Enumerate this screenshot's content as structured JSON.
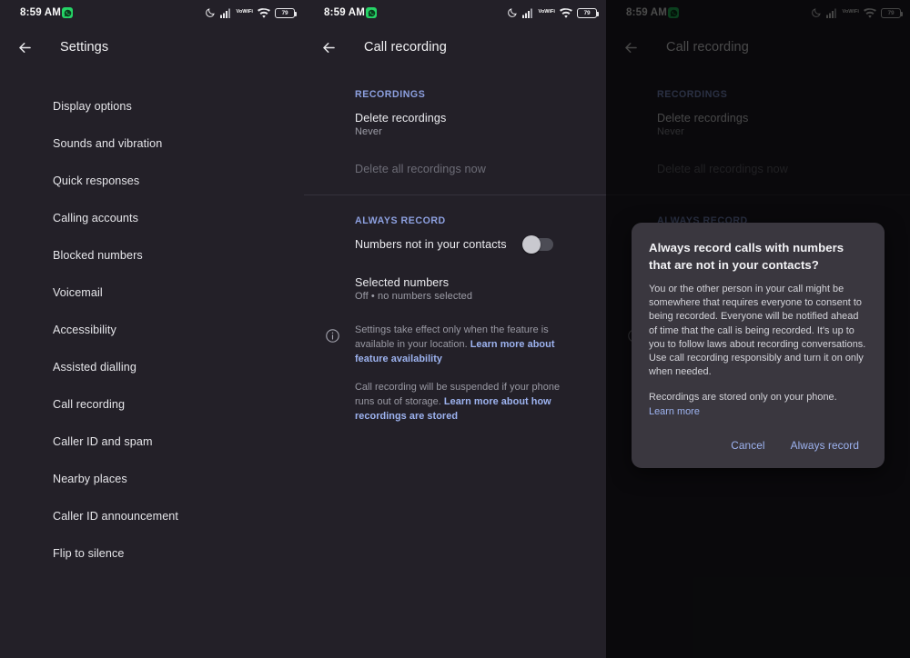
{
  "status_bar": {
    "time": "8:59 AM",
    "notification_icon": "whatsapp-icon",
    "dnd_icon": "moon-icon",
    "signal_icon": "cellular-signal-icon",
    "vowifi_top": "Vo",
    "vowifi_bottom": "WiFi",
    "wifi_icon": "wifi-icon",
    "battery_level": "79"
  },
  "colors": {
    "panel_bg": "#232028",
    "section_accent": "#8da0e0",
    "link": "#9db3f0",
    "dialog_bg": "#3a373f",
    "notification_green": "#25d366"
  },
  "panel_settings": {
    "title": "Settings",
    "back_icon": "back-arrow-icon",
    "items": [
      {
        "label": "Display options"
      },
      {
        "label": "Sounds and vibration"
      },
      {
        "label": "Quick responses"
      },
      {
        "label": "Calling accounts"
      },
      {
        "label": "Blocked numbers"
      },
      {
        "label": "Voicemail"
      },
      {
        "label": "Accessibility"
      },
      {
        "label": "Assisted dialling"
      },
      {
        "label": "Call recording"
      },
      {
        "label": "Caller ID and spam"
      },
      {
        "label": "Nearby places"
      },
      {
        "label": "Caller ID announcement"
      },
      {
        "label": "Flip to silence"
      }
    ]
  },
  "panel_call_recording": {
    "title": "Call recording",
    "back_icon": "back-arrow-icon",
    "sections": {
      "recordings_header": "RECORDINGS",
      "delete_recordings_title": "Delete recordings",
      "delete_recordings_value": "Never",
      "delete_all_now": "Delete all recordings now",
      "always_record_header": "ALWAYS RECORD",
      "numbers_not_in_contacts": "Numbers not in your contacts",
      "numbers_not_in_contacts_state": "off",
      "selected_numbers_title": "Selected numbers",
      "selected_numbers_value": "Off • no numbers selected"
    },
    "footer": {
      "info_icon": "info-icon",
      "paragraph_1_text": "Settings take effect only when the feature is available in your location. ",
      "paragraph_1_link": "Learn more about feature availability",
      "paragraph_2_text": "Call recording will be suspended if your phone runs out of storage. ",
      "paragraph_2_link": "Learn more about how recordings are stored"
    }
  },
  "dialog": {
    "title": "Always record calls with numbers that are not in your contacts?",
    "body_1": "You or the other person in your call might be somewhere that requires everyone to consent to being recorded. Everyone will be notified ahead of time that the call is being recorded. It's up to you to follow laws about recording conversations. Use call recording responsibly and turn it on only when needed.",
    "body_2": "Recordings are stored only on your phone.",
    "body_2_link": "Learn more",
    "cancel_label": "Cancel",
    "confirm_label": "Always record"
  }
}
